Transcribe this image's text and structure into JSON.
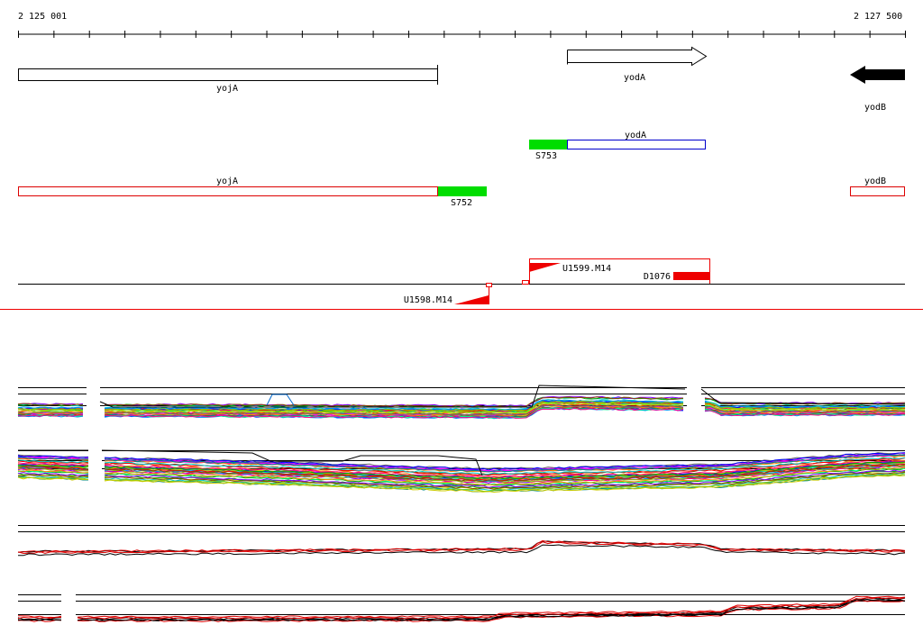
{
  "coordinates": {
    "start": "2 125 001",
    "end": "2 127 500"
  },
  "annotation": {
    "genes": [
      {
        "name": "yojA",
        "strand": "+",
        "style": "open"
      },
      {
        "name": "yodA",
        "strand": "+",
        "style": "arrow-open"
      },
      {
        "name": "yodB",
        "strand": "-",
        "style": "arrow-filled"
      }
    ],
    "transcripts": [
      {
        "name": "yodA",
        "color": "#0000cc"
      },
      {
        "name": "yojA",
        "color": "#dd0000"
      },
      {
        "name": "yodB",
        "color": "#dd0000"
      }
    ],
    "segments": [
      {
        "name": "S753",
        "color": "#00dd00"
      },
      {
        "name": "S752",
        "color": "#00dd00"
      }
    ],
    "features": [
      {
        "name": "U1599.M14",
        "type": "upshift",
        "color": "#ee0000"
      },
      {
        "name": "U1598.M14",
        "type": "upshift",
        "color": "#ee0000"
      },
      {
        "name": "D1076",
        "type": "downshift",
        "color": "#ee0000"
      }
    ]
  },
  "expression_panels": [
    {
      "name": "tiling-array-profiles",
      "palette": "multicolor"
    },
    {
      "name": "condition-profiles",
      "palette": "multicolor"
    },
    {
      "name": "strand-summary",
      "palette": [
        "#000000",
        "#dd0000"
      ]
    },
    {
      "name": "strand-summary-2",
      "palette": [
        "#000000",
        "#dd0000"
      ]
    }
  ],
  "colors": {
    "accent": "#ee0000",
    "segment": "#00dd00",
    "transcript": "#0000cc",
    "axis": "#000000"
  }
}
